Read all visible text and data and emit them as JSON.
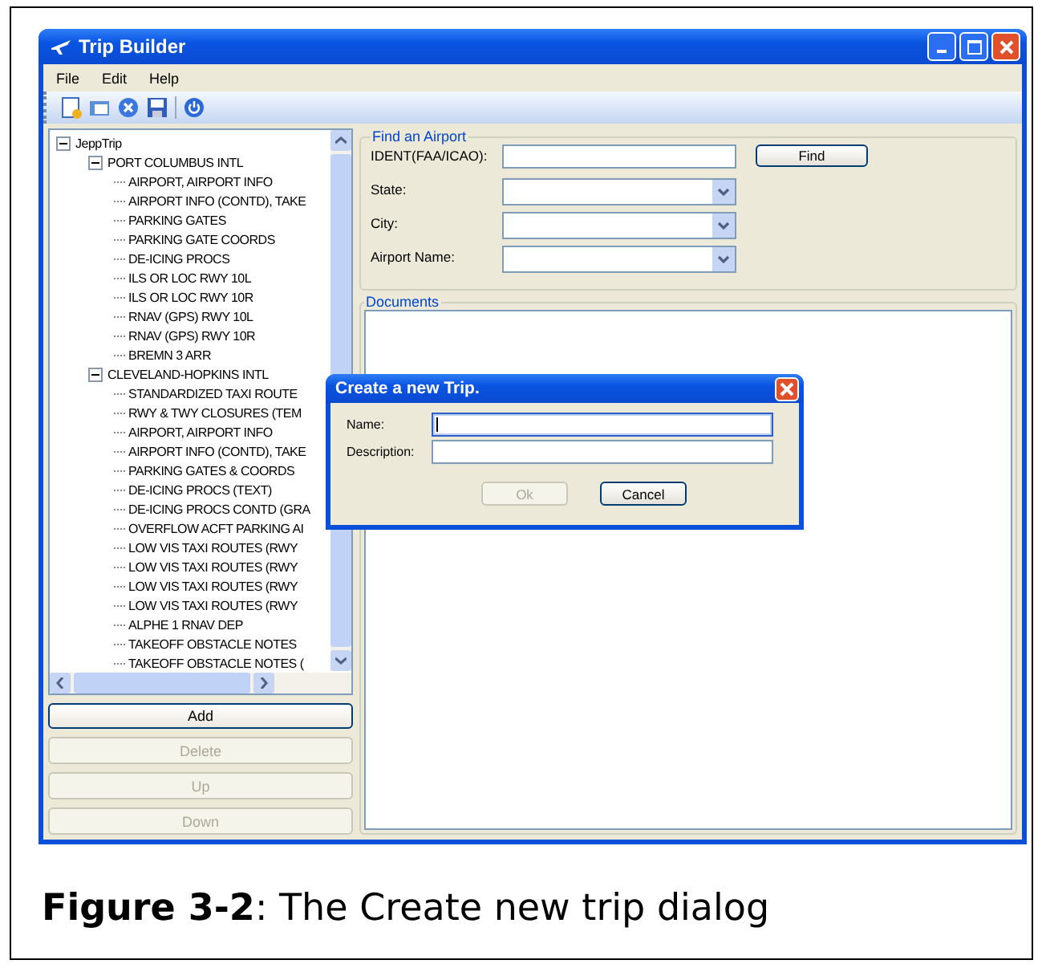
{
  "window": {
    "title": "Trip Builder"
  },
  "menu": [
    "File",
    "Edit",
    "Help"
  ],
  "tree": {
    "label": "JeppTrip",
    "expanded": true,
    "children": [
      {
        "label": "PORT COLUMBUS INTL",
        "expanded": true,
        "children": [
          {
            "label": "AIRPORT, AIRPORT INFO"
          },
          {
            "label": "AIRPORT INFO (CONTD), TAKE"
          },
          {
            "label": "PARKING GATES"
          },
          {
            "label": "PARKING GATE COORDS"
          },
          {
            "label": "DE-ICING PROCS"
          },
          {
            "label": "ILS OR LOC RWY 10L"
          },
          {
            "label": "ILS OR LOC RWY 10R"
          },
          {
            "label": "RNAV (GPS) RWY 10L"
          },
          {
            "label": "RNAV (GPS) RWY 10R"
          },
          {
            "label": "BREMN 3 ARR"
          }
        ]
      },
      {
        "label": "CLEVELAND-HOPKINS INTL",
        "expanded": true,
        "children": [
          {
            "label": "STANDARDIZED TAXI ROUTE"
          },
          {
            "label": "RWY & TWY CLOSURES (TEM"
          },
          {
            "label": "AIRPORT, AIRPORT INFO"
          },
          {
            "label": "AIRPORT INFO (CONTD), TAKE"
          },
          {
            "label": "PARKING GATES & COORDS"
          },
          {
            "label": "DE-ICING PROCS (TEXT)"
          },
          {
            "label": "DE-ICING PROCS CONTD (GRA"
          },
          {
            "label": "OVERFLOW ACFT PARKING AI"
          },
          {
            "label": "LOW VIS TAXI ROUTES (RWY"
          },
          {
            "label": "LOW VIS TAXI ROUTES (RWY"
          },
          {
            "label": "LOW VIS TAXI ROUTES (RWY"
          },
          {
            "label": "LOW VIS TAXI ROUTES (RWY"
          },
          {
            "label": "ALPHE 1 RNAV DEP"
          },
          {
            "label": "TAKEOFF OBSTACLE NOTES"
          },
          {
            "label": "TAKEOFF OBSTACLE NOTES ("
          }
        ]
      }
    ]
  },
  "buttons": [
    {
      "label": "Add",
      "disabled": false
    },
    {
      "label": "Delete",
      "disabled": true
    },
    {
      "label": "Up",
      "disabled": true
    },
    {
      "label": "Down",
      "disabled": true
    }
  ],
  "find_airport": {
    "title": "Find an Airport",
    "ident_label": "IDENT(FAA/ICAO):",
    "find_button": "Find",
    "dropdowns": [
      {
        "label": "State:"
      },
      {
        "label": "City:"
      },
      {
        "label": "Airport Name:"
      }
    ]
  },
  "documents": {
    "title": "Documents"
  },
  "dialog": {
    "title": "Create a new Trip.",
    "fields": [
      {
        "label": "Name:",
        "focused": true
      },
      {
        "label": "Description:",
        "focused": false
      }
    ],
    "buttons": [
      {
        "label": "Ok",
        "disabled": true
      },
      {
        "label": "Cancel",
        "disabled": false
      }
    ]
  },
  "caption": "**Figure 3-2**: The Create new trip dialog"
}
